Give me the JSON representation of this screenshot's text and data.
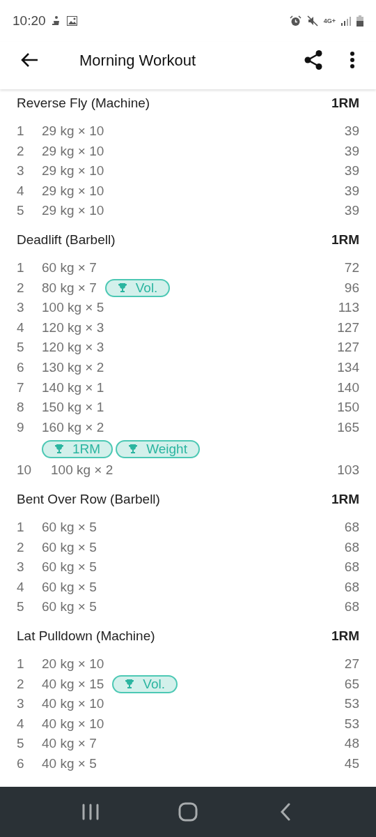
{
  "status_bar": {
    "time": "10:20",
    "network": "4G+"
  },
  "app_bar": {
    "title": "Morning Workout"
  },
  "exercises": [
    {
      "name": "Reverse Fly (Machine)",
      "column": "1RM",
      "sets": [
        {
          "number": "1",
          "performance": "29 kg × 10",
          "one_rm": "39"
        },
        {
          "number": "2",
          "performance": "29 kg × 10",
          "one_rm": "39"
        },
        {
          "number": "3",
          "performance": "29 kg × 10",
          "one_rm": "39"
        },
        {
          "number": "4",
          "performance": "29 kg × 10",
          "one_rm": "39"
        },
        {
          "number": "5",
          "performance": "29 kg × 10",
          "one_rm": "39"
        }
      ]
    },
    {
      "name": "Deadlift (Barbell)",
      "column": "1RM",
      "sets": [
        {
          "number": "1",
          "performance": "60 kg × 7",
          "one_rm": "72"
        },
        {
          "number": "2",
          "performance": "80 kg × 7",
          "one_rm": "96",
          "records": [
            "Vol."
          ],
          "kind": "inline"
        },
        {
          "number": "3",
          "performance": "100 kg × 5",
          "one_rm": "113"
        },
        {
          "number": "4",
          "performance": "120 kg × 3",
          "one_rm": "127"
        },
        {
          "number": "5",
          "performance": "120 kg × 3",
          "one_rm": "127"
        },
        {
          "number": "6",
          "performance": "130 kg × 2",
          "one_rm": "134"
        },
        {
          "number": "7",
          "performance": "140 kg × 1",
          "one_rm": "140"
        },
        {
          "number": "8",
          "performance": "150 kg × 1",
          "one_rm": "150"
        },
        {
          "number": "9",
          "performance": "160 kg × 2",
          "one_rm": "165",
          "records": [
            "1RM",
            "Weight"
          ],
          "kind": "below"
        },
        {
          "number": "10",
          "performance": "100 kg × 2",
          "one_rm": "103"
        }
      ]
    },
    {
      "name": "Bent Over Row (Barbell)",
      "column": "1RM",
      "sets": [
        {
          "number": "1",
          "performance": "60 kg × 5",
          "one_rm": "68"
        },
        {
          "number": "2",
          "performance": "60 kg × 5",
          "one_rm": "68"
        },
        {
          "number": "3",
          "performance": "60 kg × 5",
          "one_rm": "68"
        },
        {
          "number": "4",
          "performance": "60 kg × 5",
          "one_rm": "68"
        },
        {
          "number": "5",
          "performance": "60 kg × 5",
          "one_rm": "68"
        }
      ]
    },
    {
      "name": "Lat Pulldown (Machine)",
      "column": "1RM",
      "sets": [
        {
          "number": "1",
          "performance": "20 kg × 10",
          "one_rm": "27"
        },
        {
          "number": "2",
          "performance": "40 kg × 15",
          "one_rm": "65",
          "records": [
            "Vol."
          ],
          "kind": "inline"
        },
        {
          "number": "3",
          "performance": "40 kg × 10",
          "one_rm": "53"
        },
        {
          "number": "4",
          "performance": "40 kg × 10",
          "one_rm": "53"
        },
        {
          "number": "5",
          "performance": "40 kg × 7",
          "one_rm": "48"
        },
        {
          "number": "6",
          "performance": "40 kg × 5",
          "one_rm": "45"
        }
      ]
    }
  ]
}
